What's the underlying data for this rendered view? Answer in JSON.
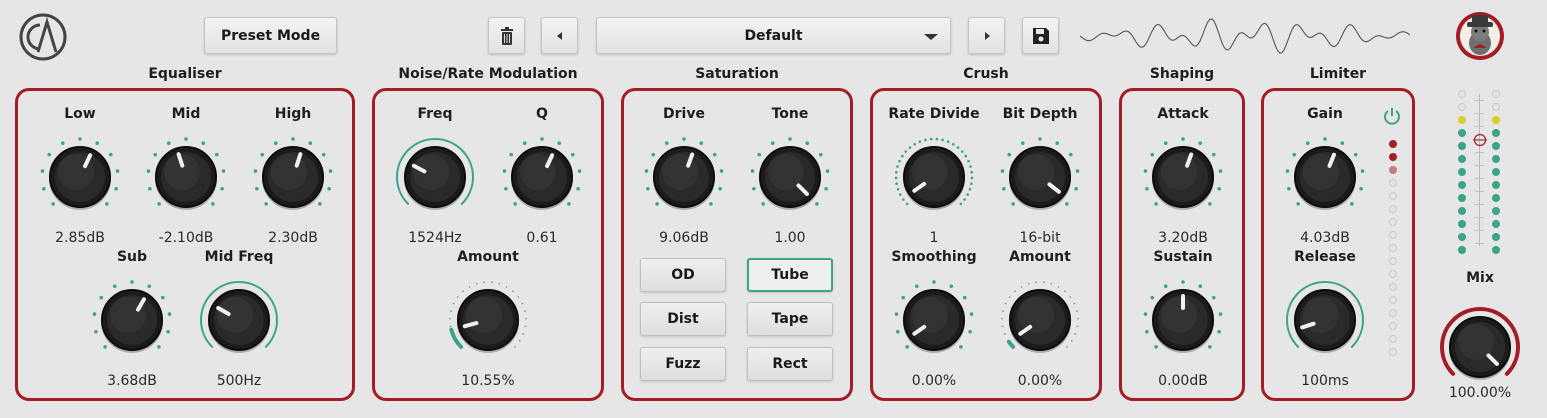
{
  "header": {
    "preset_mode_label": "Preset Mode",
    "preset_name": "Default",
    "icons": {
      "logo": "ca-logo-icon",
      "trash": "trash-icon",
      "prev": "left-arrow-icon",
      "next": "right-arrow-icon",
      "save": "floppy-disk-icon",
      "dropdown": "dropdown-triangle-icon",
      "avatar": "mascot-avatar-icon",
      "waveform": "waveform-display"
    }
  },
  "colors": {
    "accent_red": "#a31d24",
    "accent_teal": "#3aa38a",
    "background": "#e6e6e6"
  },
  "sections": {
    "equaliser": {
      "title": "Equaliser",
      "knobs": [
        {
          "label": "Low",
          "value": "2.85dB"
        },
        {
          "label": "Mid",
          "value": "-2.10dB"
        },
        {
          "label": "High",
          "value": "2.30dB"
        },
        {
          "label": "Sub",
          "value": "3.68dB"
        },
        {
          "label": "Mid Freq",
          "value": "500Hz"
        }
      ]
    },
    "noise": {
      "title": "Noise/Rate Modulation",
      "knobs": [
        {
          "label": "Freq",
          "value": "1524Hz"
        },
        {
          "label": "Q",
          "value": "0.61"
        },
        {
          "label": "Amount",
          "value": "10.55%"
        }
      ]
    },
    "saturation": {
      "title": "Saturation",
      "knobs": [
        {
          "label": "Drive",
          "value": "9.06dB"
        },
        {
          "label": "Tone",
          "value": "1.00"
        }
      ],
      "modes": [
        "OD",
        "Tube",
        "Dist",
        "Tape",
        "Fuzz",
        "Rect"
      ],
      "active_mode": "Tube"
    },
    "crush": {
      "title": "Crush",
      "knobs": [
        {
          "label": "Rate Divide",
          "value": "1"
        },
        {
          "label": "Bit Depth",
          "value": "16-bit"
        },
        {
          "label": "Smoothing",
          "value": "0.00%"
        },
        {
          "label": "Amount",
          "value": "0.00%"
        }
      ]
    },
    "shaping": {
      "title": "Shaping",
      "knobs": [
        {
          "label": "Attack",
          "value": "3.20dB"
        },
        {
          "label": "Sustain",
          "value": "0.00dB"
        }
      ]
    },
    "limiter": {
      "title": "Limiter",
      "knobs": [
        {
          "label": "Gain",
          "value": "4.03dB"
        },
        {
          "label": "Release",
          "value": "100ms"
        }
      ],
      "power_icon": "power-icon"
    },
    "mix": {
      "label": "Mix",
      "value": "100.00%"
    }
  }
}
